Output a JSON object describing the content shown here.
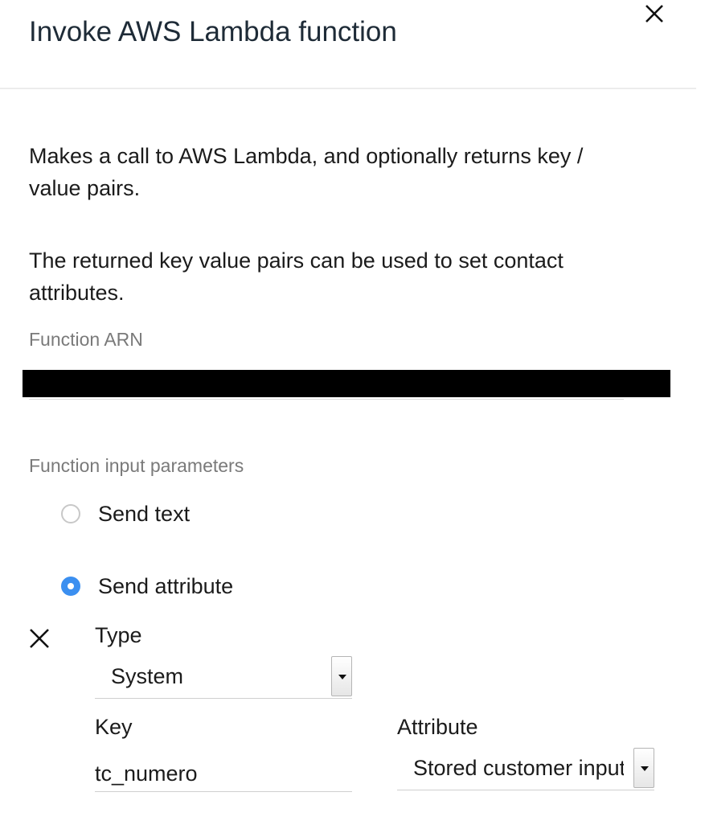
{
  "dialog": {
    "title": "Invoke AWS Lambda function",
    "description_1": "Makes a call to AWS Lambda, and optionally returns key / value pairs.",
    "description_2": "The returned key value pairs can be used to set contact attributes."
  },
  "function_arn": {
    "label": "Function ARN",
    "value": ""
  },
  "input_parameters": {
    "label": "Function input parameters",
    "options": [
      {
        "label": "Send text",
        "selected": false
      },
      {
        "label": "Send attribute",
        "selected": true
      }
    ]
  },
  "attribute_row": {
    "type_label": "Type",
    "type_value": "System",
    "key_label": "Key",
    "key_value": "tc_numero",
    "attribute_label": "Attribute",
    "attribute_value": "Stored customer input"
  },
  "colors": {
    "radio_selected": "#3b8ff0",
    "muted_label": "#7a7a7a"
  }
}
